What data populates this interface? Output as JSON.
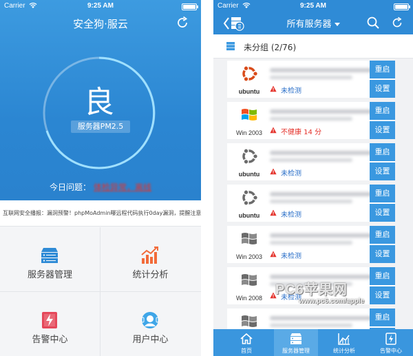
{
  "left": {
    "status": {
      "carrier": "Carrier",
      "time": "9:25 AM"
    },
    "title": "安全狗·服云",
    "grade": "良",
    "pm_label": "服务器PM2.5",
    "issue_label": "今日问题：",
    "issue_value": "体检异常，离线",
    "ticker": "互联网安全播报：漏洞预警！phpMoAdmin曝远程代码执行0day漏洞，提醒注意！！",
    "tiles": [
      {
        "label": "服务器管理",
        "icon": "server-icon",
        "color": "#2f8bd6"
      },
      {
        "label": "统计分析",
        "icon": "chart-icon",
        "color": "#f26b3a"
      },
      {
        "label": "告警中心",
        "icon": "alert-icon",
        "color": "#e5485a"
      },
      {
        "label": "用户中心",
        "icon": "user-icon",
        "color": "#3fa6e8"
      }
    ],
    "colors": {
      "hero": "#2b86d2",
      "issue_red": "#e4322b"
    }
  },
  "right": {
    "status": {
      "carrier": "Carrier",
      "time": "9:25 AM"
    },
    "title": "所有服务器",
    "group_label": "未分组 (2/76)",
    "actions": {
      "restart": "重启",
      "settings": "设置"
    },
    "servers": [
      {
        "os": "ubuntu",
        "status": "未检测",
        "status_color": "#2a6fc9"
      },
      {
        "os": "Win 2003",
        "status": "不健康 14 分",
        "status_color": "#e4322b"
      },
      {
        "os": "ubuntu",
        "status": "未检测",
        "status_color": "#2a6fc9"
      },
      {
        "os": "ubuntu",
        "status": "未检测",
        "status_color": "#2a6fc9"
      },
      {
        "os": "Win 2003",
        "status": "未检测",
        "status_color": "#2a6fc9"
      },
      {
        "os": "Win 2008",
        "status": "未检测",
        "status_color": "#2a6fc9"
      },
      {
        "os": "",
        "status": "",
        "status_color": "#2a6fc9"
      }
    ],
    "tabs": [
      {
        "label": "首页",
        "icon": "home-icon"
      },
      {
        "label": "服务器管理",
        "icon": "server-icon"
      },
      {
        "label": "统计分析",
        "icon": "chart-icon"
      },
      {
        "label": "告警中心",
        "icon": "alert-icon"
      }
    ],
    "active_tab": 1
  },
  "watermark": {
    "brand": "PC6苹果网",
    "url": "www.pc6.com/apple"
  }
}
